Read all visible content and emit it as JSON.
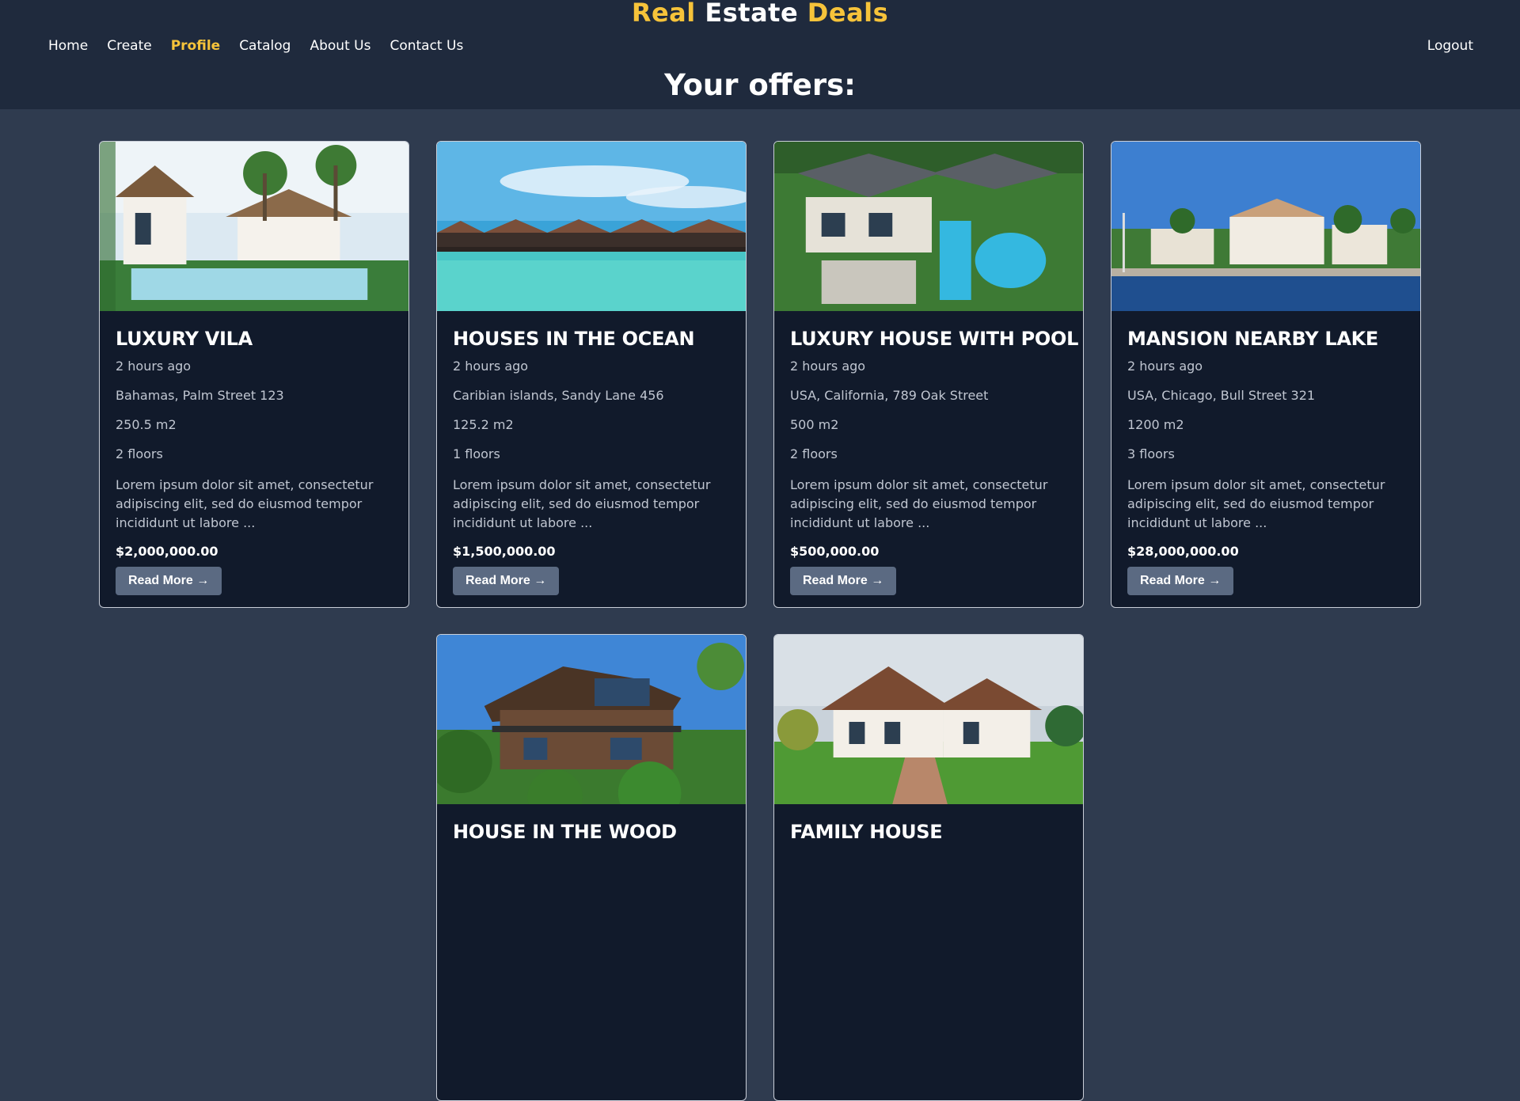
{
  "brand": {
    "part1": "Real",
    "part2": "Estate",
    "part3": "Deals"
  },
  "nav": {
    "items": [
      "Home",
      "Create",
      "Profile",
      "Catalog",
      "About Us",
      "Contact Us"
    ],
    "active": "Profile",
    "logout": "Logout"
  },
  "page_title": "Your offers:",
  "colors": {
    "accent": "#f6c33a",
    "header_bg": "#1f2a3d",
    "page_bg": "#2f3b4f",
    "card_bg": "#111a2b",
    "button_bg": "#5b6a82"
  },
  "offers": [
    {
      "title": "LUXURY VILA",
      "posted": "2 hours ago",
      "address": "Bahamas, Palm Street 123",
      "area": "250.5 m2",
      "floors": "2 floors",
      "description": "Lorem ipsum dolor sit amet, consectetur adipiscing elit, sed do eiusmod tempor incididunt ut labore ...",
      "price": "$2,000,000.00",
      "button": "Read More →",
      "image": "tropical-villa-pool-photo"
    },
    {
      "title": "HOUSES IN THE OCEAN",
      "posted": "2 hours ago",
      "address": "Caribian islands, Sandy Lane 456",
      "area": "125.2 m2",
      "floors": "1 floors",
      "description": "Lorem ipsum dolor sit amet, consectetur adipiscing elit, sed do eiusmod tempor incididunt ut labore ...",
      "price": "$1,500,000.00",
      "button": "Read More →",
      "image": "overwater-bungalows-photo"
    },
    {
      "title": "LUXURY HOUSE WITH POOL",
      "posted": "2 hours ago",
      "address": "USA, California, 789 Oak Street",
      "area": "500 m2",
      "floors": "2 floors",
      "description": "Lorem ipsum dolor sit amet, consectetur adipiscing elit, sed do eiusmod tempor incididunt ut labore ...",
      "price": "$500,000.00",
      "button": "Read More →",
      "image": "aerial-house-pool-photo"
    },
    {
      "title": "MANSION NEARBY LAKE",
      "posted": "2 hours ago",
      "address": "USA, Chicago, Bull Street 321",
      "area": "1200 m2",
      "floors": "3 floors",
      "description": "Lorem ipsum dolor sit amet, consectetur adipiscing elit, sed do eiusmod tempor incididunt ut labore ...",
      "price": "$28,000,000.00",
      "button": "Read More →",
      "image": "lakeside-mansion-photo"
    },
    {
      "title": "HOUSE IN THE WOOD",
      "image": "wooden-house-forest-photo"
    },
    {
      "title": "FAMILY HOUSE",
      "image": "family-house-lawn-photo"
    }
  ]
}
